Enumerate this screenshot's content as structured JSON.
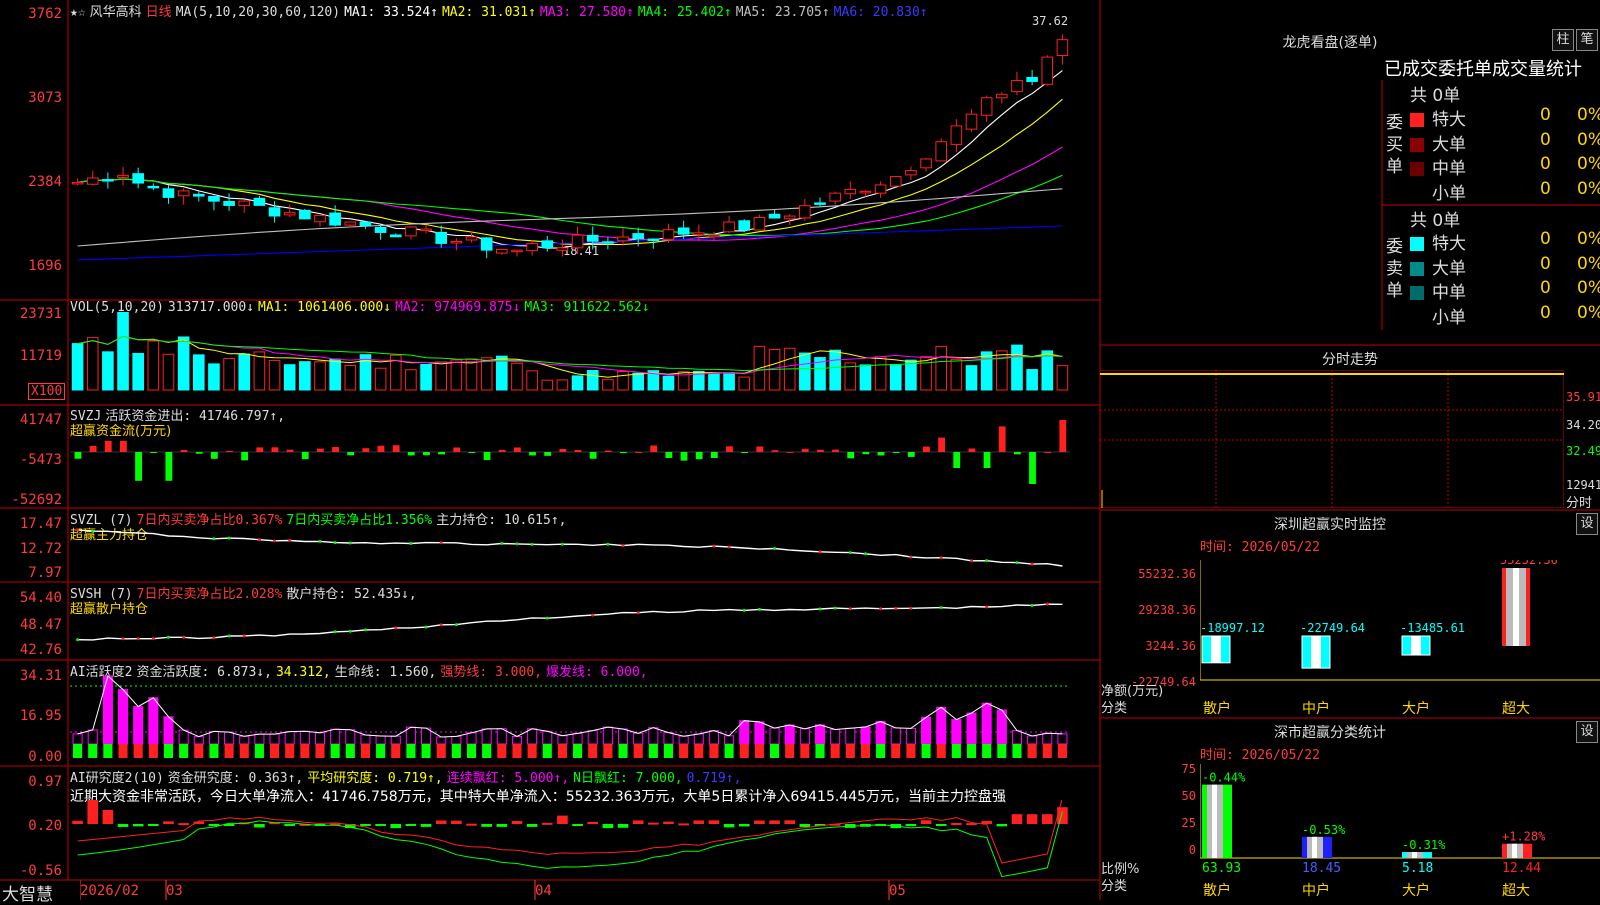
{
  "main_chart": {
    "star_marks": "★☆",
    "stock_name": "风华高科",
    "period": "日线",
    "ma_label": "MA(5,10,20,30,60,120)",
    "ma1": "MA1: 33.524↑",
    "ma2": "MA2: 31.031↑",
    "ma3": "MA3: 27.580↑",
    "ma4": "MA4: 25.402↑",
    "ma5": "MA5: 23.705↑",
    "ma6": "MA6: 20.830↑",
    "y_labels": [
      "3762",
      "3073",
      "2384",
      "1696"
    ],
    "high_label": "37.62",
    "low_label": "18.41"
  },
  "vol_panel": {
    "label": "VOL(5,10,20)",
    "value": "313717.000↓",
    "ma1": "MA1: 1061406.000↓",
    "ma2": "MA2: 974969.875↓",
    "ma3": "MA3: 911622.562↓",
    "y_labels": [
      "23731",
      "11719"
    ],
    "unit": "X100"
  },
  "svzj_panel": {
    "label": "SVZJ",
    "text": "活跃资金进出: 41746.797↑,",
    "sub": "超赢资金流(万元)",
    "y_labels": [
      "41747",
      "-5473",
      "-52692"
    ]
  },
  "svzl_panel": {
    "label": "SVZL  (7)",
    "t1": "7日内买卖净占比0.367%",
    "t2": "7日内买卖净占比1.356%",
    "t3": "主力持仓: 10.615↑,",
    "sub": "超赢主力持仓",
    "y_labels": [
      "17.47",
      "12.72",
      "7.97"
    ]
  },
  "svsh_panel": {
    "label": "SVSH  (7)",
    "t1": "7日内买卖净占比2.028%",
    "t2": "散户持仓: 52.435↓,",
    "sub": "超赢散户持仓",
    "y_labels": [
      "54.40",
      "48.47",
      "42.76"
    ]
  },
  "ai_active_panel": {
    "label": "AI活跃度2",
    "t1": "资金活跃度: 6.873↓,",
    "t2": "34.312,",
    "t3": "生命线: 1.560,",
    "t4": "强势线: 3.000,",
    "t5": "爆发线: 6.000,",
    "y_labels": [
      "34.31",
      "16.95",
      "0.00"
    ]
  },
  "ai_research_panel": {
    "label": "AI研究度2(10)",
    "t1": "资金研究度: 0.363↑,",
    "t2": "平均研究度: 0.719↑,",
    "t3": "连续飘红: 5.000↑,",
    "t4": "N日飘红: 7.000,",
    "t5": "0.719↑,",
    "summary": "近期大资金非常活跃，今日大单净流入：41746.758万元，其中特大单净流入：55232.363万元，大单5日累计净入69415.445万元，当前主力控盘强",
    "y_labels": [
      "0.97",
      "0.20",
      "-0.56"
    ]
  },
  "bottom_bar": {
    "brand": "大智慧",
    "dates": [
      "2026/02",
      "03",
      "04",
      "05"
    ]
  },
  "right": {
    "dragon_title": "龙虎看盘(逐单)",
    "btn_bar": "柱",
    "btn_pen": "笔",
    "tabs": "已成交委托单成交量统计",
    "buy": {
      "vertical": "委买单",
      "count": "共 0单",
      "rows": [
        {
          "name": "特大",
          "v": "0",
          "p": "0%",
          "c": "#ff2020"
        },
        {
          "name": "大单",
          "v": "0",
          "p": "0%",
          "c": "#8b0000"
        },
        {
          "name": "中单",
          "v": "0",
          "p": "0%",
          "c": "#6b0000"
        },
        {
          "name": "小单",
          "v": "0",
          "p": "0%",
          "c": ""
        }
      ]
    },
    "sell": {
      "vertical": "委卖单",
      "count": "共 0单",
      "rows": [
        {
          "name": "特大",
          "v": "0",
          "p": "0%",
          "c": "#00ffff"
        },
        {
          "name": "大单",
          "v": "0",
          "p": "0%",
          "c": "#008b8b"
        },
        {
          "name": "中单",
          "v": "0",
          "p": "0%",
          "c": "#006b6b"
        },
        {
          "name": "小单",
          "v": "0",
          "p": "0%",
          "c": ""
        }
      ]
    },
    "intraday": {
      "title": "分时走势",
      "y_labels": [
        "35.91",
        "34.20",
        "32.49",
        "12941"
      ],
      "bottom": "分时"
    },
    "sz_monitor": {
      "title": "深圳超赢实时监控",
      "btn": "设",
      "time": "时间: 2026/05/22",
      "y_labels": [
        "55232.36",
        "29238.36",
        "3244.36",
        "-22749.64"
      ],
      "bars": [
        {
          "label": "散户",
          "value": "-18997.12"
        },
        {
          "label": "中户",
          "value": "-22749.64"
        },
        {
          "label": "大户",
          "value": "-13485.61"
        },
        {
          "label": "超大",
          "value": "55232.36"
        }
      ],
      "net_label": "净额(万元)",
      "cat_label": "分类"
    },
    "sz_class": {
      "title": "深市超赢分类统计",
      "btn": "设",
      "time": "时间: 2026/05/22",
      "y_labels": [
        "75",
        "50",
        "25",
        "0"
      ],
      "bars": [
        {
          "label": "散户",
          "pct": "-0.44%",
          "value": "63.93"
        },
        {
          "label": "中户",
          "pct": "-0.53%",
          "value": "18.45"
        },
        {
          "label": "大户",
          "pct": "-0.31%",
          "value": "5.18"
        },
        {
          "label": "超大",
          "pct": "+1.28%",
          "value": "12.44"
        }
      ],
      "ratio_label": "比例%",
      "cat_label": "分类"
    }
  },
  "colors": {
    "up": "#ff2020",
    "down": "#00ffff",
    "border": "#c00000",
    "ma1": "#ffffff",
    "ma2": "#ffff00",
    "ma3": "#ff00ff",
    "ma4": "#00ff00",
    "ma5": "#c0c0c0",
    "ma6": "#0000ff"
  }
}
